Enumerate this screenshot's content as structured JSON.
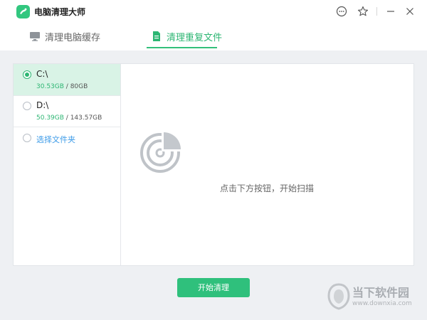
{
  "app": {
    "title": "电脑清理大师"
  },
  "window_controls": [
    {
      "icon": "chat-icon"
    },
    {
      "icon": "star-icon"
    },
    {
      "icon": "minimize-icon"
    },
    {
      "icon": "close-icon"
    }
  ],
  "tabs": [
    {
      "label": "清理电脑缓存",
      "icon": "monitor-icon",
      "active": false
    },
    {
      "label": "清理重复文件",
      "icon": "document-icon",
      "active": true
    }
  ],
  "drives": [
    {
      "name": "C:\\",
      "used": "30.53GB",
      "total": "80GB",
      "selected": true
    },
    {
      "name": "D:\\",
      "used": "50.39GB",
      "total": "143.57GB",
      "selected": false
    }
  ],
  "sidebar": {
    "choose_folder": "选择文件夹"
  },
  "main": {
    "hint": "点击下方按钮，开始扫描",
    "scan_icon": "radar-scan-icon"
  },
  "actions": {
    "start": "开始清理"
  },
  "watermark": {
    "title": "当下软件园",
    "url": "www.downxia.com"
  },
  "colors": {
    "accent": "#2fc07c",
    "link": "#3c9be8",
    "selected_bg": "#d9f3e6"
  }
}
